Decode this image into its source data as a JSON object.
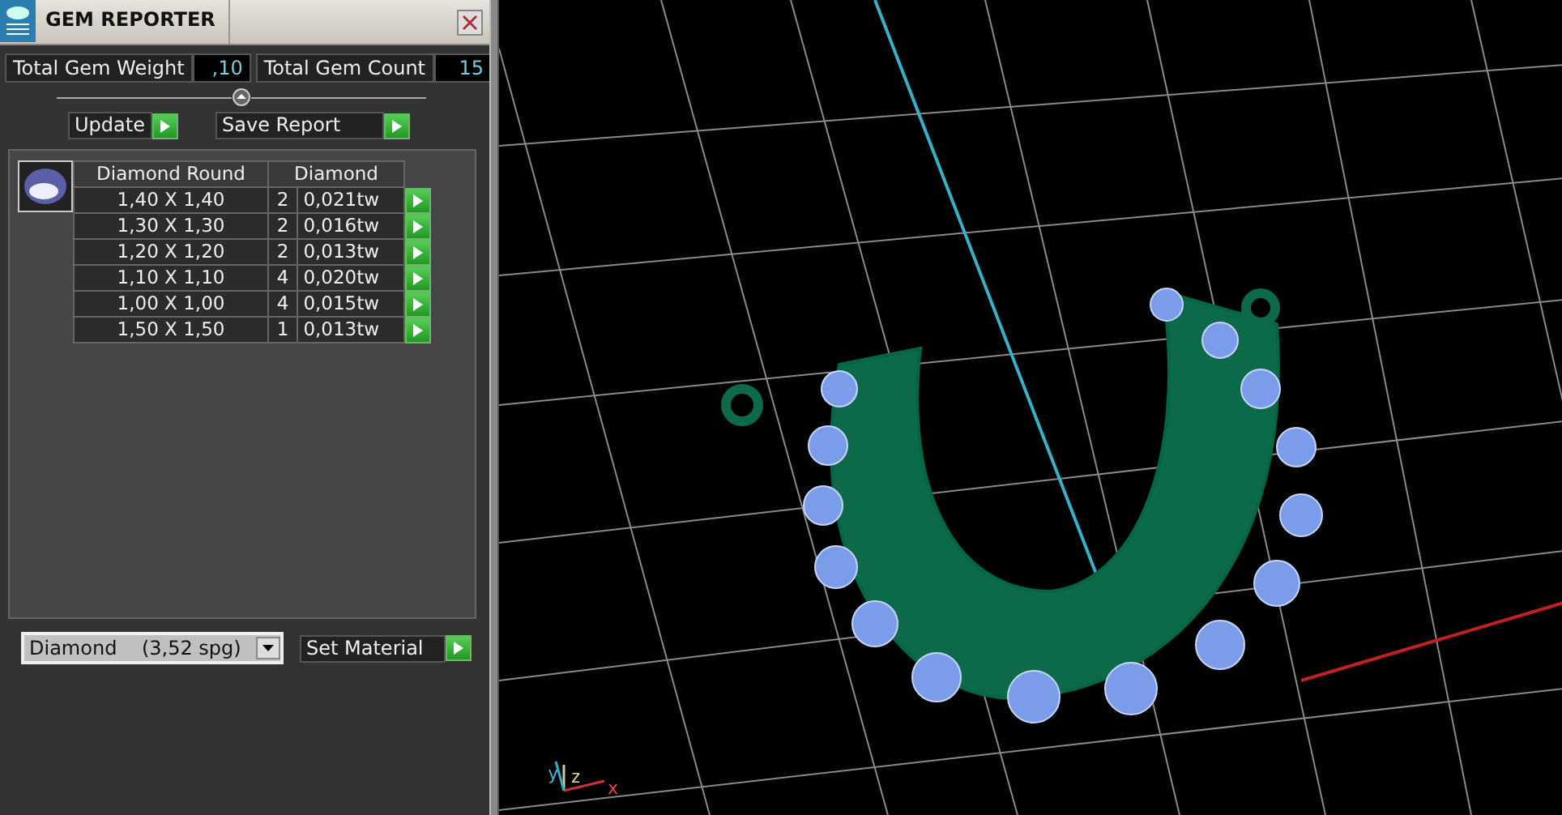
{
  "window": {
    "title": "GEM REPORTER"
  },
  "totals": [
    {
      "label": "Total Gem Weight",
      "value": ",10"
    },
    {
      "label": "Total Gem Count",
      "value": "15"
    }
  ],
  "actions": [
    "Update",
    "Save Report"
  ],
  "gem_table": {
    "columns": [
      "Diamond Round",
      "Diamond"
    ],
    "rows": [
      {
        "size": "1,40 X 1,40",
        "count": "2",
        "weight": "0,021tw"
      },
      {
        "size": "1,30 X 1,30",
        "count": "2",
        "weight": "0,016tw"
      },
      {
        "size": "1,20 X 1,20",
        "count": "2",
        "weight": "0,013tw"
      },
      {
        "size": "1,10 X 1,10",
        "count": "4",
        "weight": "0,020tw"
      },
      {
        "size": "1,00 X 1,00",
        "count": "4",
        "weight": "0,015tw"
      },
      {
        "size": "1,50 X 1,50",
        "count": "1",
        "weight": "0,013tw"
      }
    ]
  },
  "material": {
    "value": "Diamond    (3,52 spg)",
    "button": "Set Material"
  },
  "viewport": {
    "axis_labels": [
      "y",
      "z",
      "x"
    ]
  }
}
